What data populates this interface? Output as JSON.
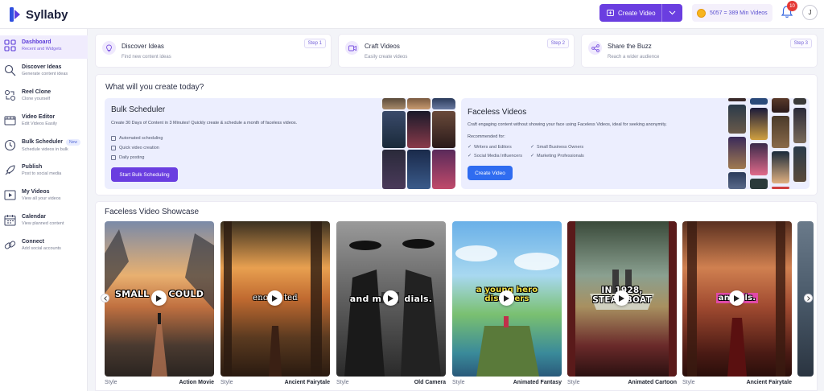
{
  "app": {
    "name": "Syllaby"
  },
  "header": {
    "create_label": "Create Video",
    "credits_label": "5057 = 389 Min Videos",
    "notifications": "10",
    "avatar_initial": "J"
  },
  "sidebar": {
    "items": [
      {
        "title": "Dashboard",
        "sub": "Recent and Widgets",
        "icon": "grid-icon",
        "active": true
      },
      {
        "title": "Discover Ideas",
        "sub": "Generate content ideas",
        "icon": "search-icon"
      },
      {
        "title": "Reel Clone",
        "sub": "Clone yourself",
        "icon": "clone-icon"
      },
      {
        "title": "Video Editor",
        "sub": "Edit Videos Easily",
        "icon": "video-editor-icon"
      },
      {
        "title": "Bulk Scheduler",
        "sub": "Schedule videos in bulk",
        "icon": "clock-icon",
        "badge": "New"
      },
      {
        "title": "Publish",
        "sub": "Post to social media",
        "icon": "rocket-icon"
      },
      {
        "title": "My Videos",
        "sub": "View all your videos",
        "icon": "videos-icon"
      },
      {
        "title": "Calendar",
        "sub": "View planned content",
        "icon": "calendar-icon"
      },
      {
        "title": "Connect",
        "sub": "Add social accounts",
        "icon": "link-icon"
      }
    ]
  },
  "steps": [
    {
      "title": "Discover Ideas",
      "sub": "Find new content ideas",
      "tag": "Step 1",
      "icon": "lightbulb-icon"
    },
    {
      "title": "Craft Videos",
      "sub": "Easily create videos",
      "tag": "Step 2",
      "icon": "camera-icon"
    },
    {
      "title": "Share the Buzz",
      "sub": "Reach a wider audience",
      "tag": "Step 3",
      "icon": "share-icon"
    }
  ],
  "create": {
    "title": "What will you create today?",
    "bulk": {
      "title": "Bulk Scheduler",
      "desc": "Create 30 Days of Content in 3 Minutes! Quickly create & schedule a month of faceless videos.",
      "features": [
        "Automated scheduling",
        "Quick video creation",
        "Daily posting"
      ],
      "button": "Start Bulk Scheduling"
    },
    "faceless": {
      "title": "Faceless Videos",
      "desc": "Craft engaging content without showing your face using Faceless Videos, ideal for seeking anonymity.",
      "rec_label": "Recommended for:",
      "recommended": [
        "Writers and Editors",
        "Small Business Owners",
        "Social Media Influencers",
        "Marketing Professionals"
      ],
      "button": "Create Video"
    }
  },
  "showcase": {
    "title": "Faceless Video Showcase",
    "style_key": "Style",
    "videos": [
      {
        "caption": "SMALL      COULD",
        "style": "Action Movie"
      },
      {
        "caption": "enc      ted",
        "style": "Ancient Fairytale"
      },
      {
        "caption": "and m       dials.",
        "style": "Old Camera"
      },
      {
        "caption": "a young hero\ndiscovers",
        "style": "Animated Fantasy"
      },
      {
        "caption": "IN 1928,\nSTEAMBOAT",
        "style": "Animated Cartoon"
      },
      {
        "caption": "an     ls.",
        "style": "Ancient Fairytale"
      }
    ]
  },
  "colors": {
    "accent": "#6a3ee0",
    "blue": "#2f6cf0"
  }
}
